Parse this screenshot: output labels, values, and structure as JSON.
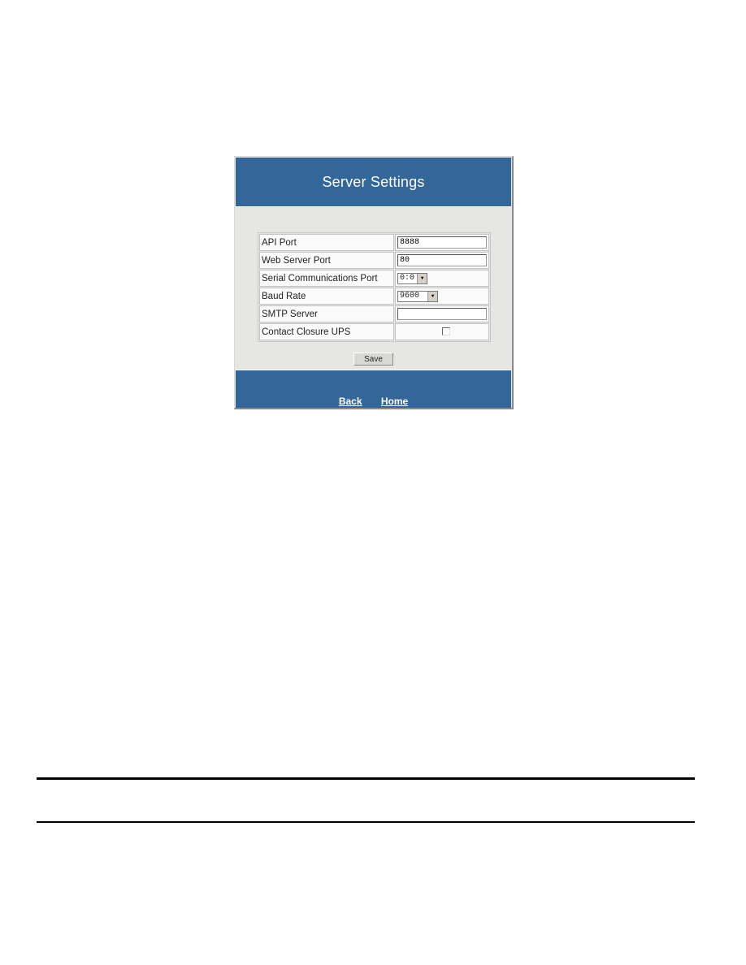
{
  "header": {
    "title": "Server Settings"
  },
  "settings": {
    "rows": [
      {
        "label": "API Port",
        "type": "text",
        "value": "8888"
      },
      {
        "label": "Web Server Port",
        "type": "text",
        "value": "80"
      },
      {
        "label": "Serial Communications Port",
        "type": "select",
        "value": "0:0"
      },
      {
        "label": "Baud Rate",
        "type": "select",
        "value": "9600"
      },
      {
        "label": "SMTP Server",
        "type": "text",
        "value": ""
      },
      {
        "label": "Contact Closure UPS",
        "type": "checkbox",
        "checked": false
      }
    ]
  },
  "actions": {
    "save_label": "Save"
  },
  "footer": {
    "links": [
      {
        "label": "Back"
      },
      {
        "label": "Home"
      }
    ]
  },
  "colors": {
    "header_blue": "#336699",
    "body_gray": "#e6e6e4"
  }
}
